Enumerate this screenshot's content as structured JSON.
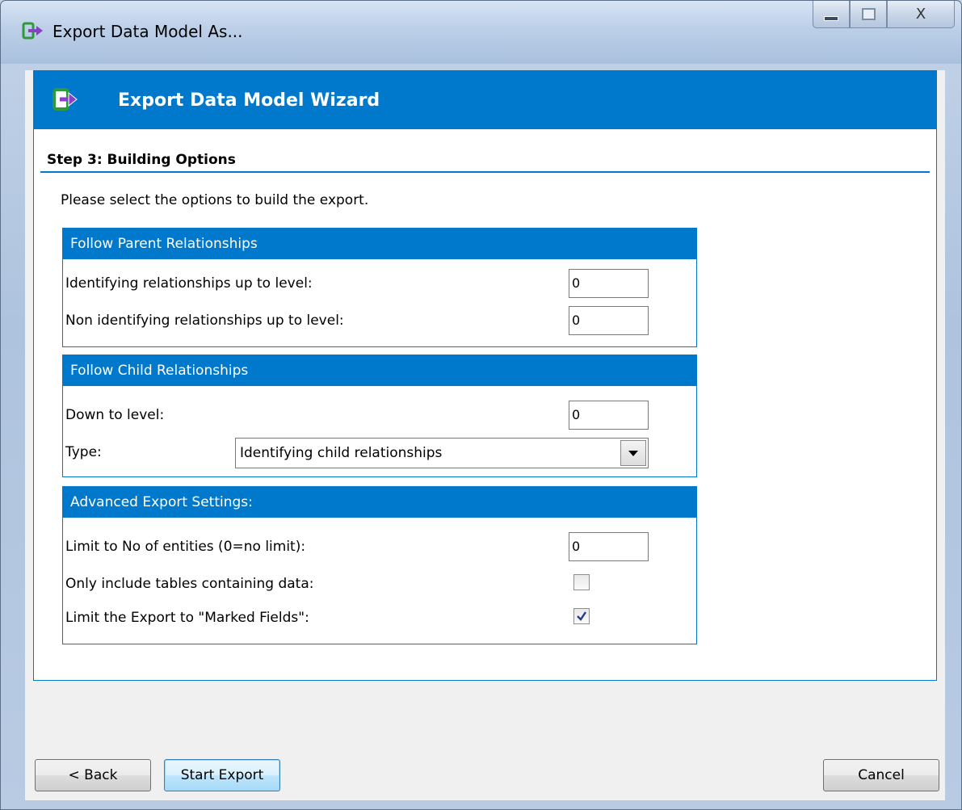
{
  "window": {
    "title": "Export Data Model As...",
    "close_glyph": "X"
  },
  "wizard": {
    "title": "Export Data Model Wizard",
    "step": "Step 3: Building Options",
    "instruction": "Please select the options to build the export."
  },
  "parent_group": {
    "heading": "Follow Parent Relationships",
    "identifying_label": "Identifying relationships up to level:",
    "identifying_value": "0",
    "non_identifying_label": "Non identifying relationships up to level:",
    "non_identifying_value": "0"
  },
  "child_group": {
    "heading": "Follow Child Relationships",
    "down_label": "Down to level:",
    "down_value": "0",
    "type_label": "Type:",
    "type_value": "Identifying child relationships"
  },
  "advanced_group": {
    "heading": "Advanced Export Settings:",
    "limit_label": "Limit to No of entities (0=no limit):",
    "limit_value": "0",
    "only_data_label": "Only include tables containing data:",
    "only_data_checked": false,
    "marked_fields_label": "Limit the Export to \"Marked Fields\":",
    "marked_fields_checked": true
  },
  "buttons": {
    "back": "< Back",
    "start_export": "Start Export",
    "cancel": "Cancel"
  },
  "colors": {
    "accent": "#0078cc",
    "icon_green": "#2e9a3c",
    "icon_purple": "#8a3fc7"
  },
  "icons": {
    "app": "export-arrow-icon",
    "dropdown": "chevron-down-icon",
    "check": "checkmark-icon"
  }
}
